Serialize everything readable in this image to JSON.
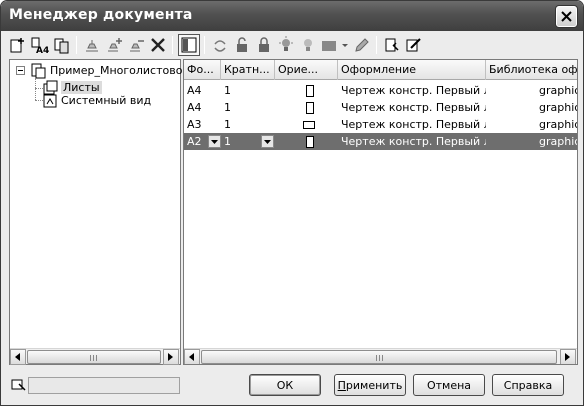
{
  "window": {
    "title": "Менеджер документа"
  },
  "toolbar": {
    "buttons": [
      {
        "name": "add-sheet-icon"
      },
      {
        "name": "add-format-icon"
      },
      {
        "name": "copy-sheet-icon"
      },
      {
        "name": "stamp-icon"
      },
      {
        "name": "stamp-add-icon"
      },
      {
        "name": "stamp-remove-icon"
      },
      {
        "name": "delete-icon"
      },
      {
        "name": "panel-view-icon"
      },
      {
        "name": "link-icon"
      },
      {
        "name": "unlock-icon"
      },
      {
        "name": "lock-icon"
      },
      {
        "name": "bulb-on-icon"
      },
      {
        "name": "bulb-off-icon"
      },
      {
        "name": "color-fill-icon"
      },
      {
        "name": "edit-style-icon"
      },
      {
        "name": "sheet-properties-icon"
      },
      {
        "name": "sheet-edit-icon"
      }
    ]
  },
  "tree": {
    "root_label": "Пример_Многолистовой",
    "items": [
      {
        "label": "Листы"
      },
      {
        "label": "Системный вид"
      }
    ]
  },
  "table": {
    "columns": [
      "Фо...",
      "Кратн...",
      "Орие...",
      "Оформление",
      "Библиотека оф"
    ],
    "rows": [
      {
        "format": "A4",
        "multiplicity": "1",
        "orientation": "portrait",
        "design": "Чертеж констр. Первый лист",
        "library": "graphic."
      },
      {
        "format": "A4",
        "multiplicity": "1",
        "orientation": "portrait",
        "design": "Чертеж констр. Первый лист",
        "library": "graphic."
      },
      {
        "format": "A3",
        "multiplicity": "1",
        "orientation": "landscape",
        "design": "Чертеж констр. Первый лист",
        "library": "graphic."
      },
      {
        "format": "A2",
        "multiplicity": "1",
        "orientation": "portrait",
        "design": "Чертеж констр. Первый лист",
        "library": "graphic.",
        "selected": true
      }
    ]
  },
  "status": {
    "text": ""
  },
  "buttons": {
    "ok": "ОК",
    "apply_first": "П",
    "apply_rest": "рименить",
    "cancel": "Отмена",
    "help": "Справка"
  },
  "colors": {
    "selection": "#6e6e6e",
    "titlebar": "#505050"
  }
}
